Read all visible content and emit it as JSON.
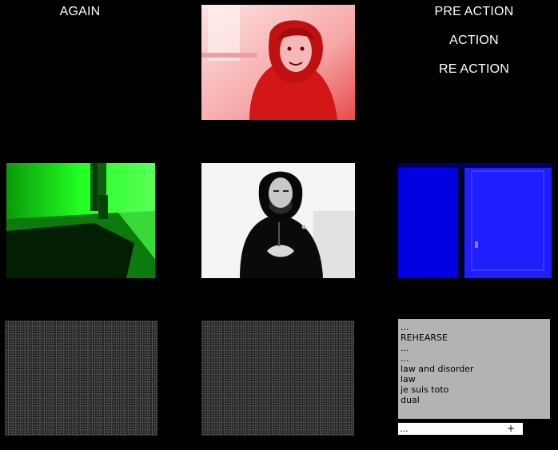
{
  "labels": {
    "again": "AGAIN",
    "pre_action": "PRE ACTION",
    "action": "ACTION",
    "re_action": "RE ACTION"
  },
  "tiles": {
    "red": {
      "tint": "#e01c1c"
    },
    "green": {
      "tint": "#12e312"
    },
    "bw": {
      "tint": "#ffffff"
    },
    "blue": {
      "tint": "#1212ff"
    }
  },
  "log": {
    "lines": [
      "...",
      "REHEARSE",
      "...",
      "...",
      "law and disorder",
      "law",
      "je suis toto",
      "dual"
    ]
  },
  "command": {
    "value": "...",
    "add_label": "+"
  }
}
